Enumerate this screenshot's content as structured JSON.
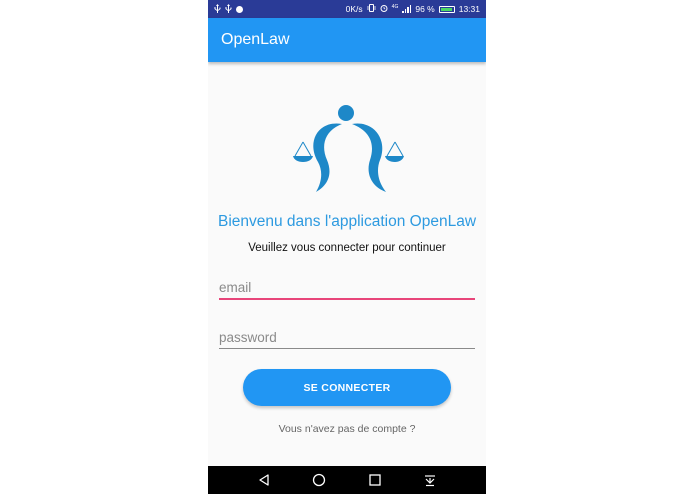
{
  "status_bar": {
    "speed": "0K/s",
    "network": "4G",
    "battery_percent": "96 %",
    "time": "13:31",
    "battery_color": "#4cd964",
    "icons": [
      "usb-icon",
      "usb-icon",
      "messenger-icon",
      "vibrate-icon",
      "alarm-icon",
      "signal-icon",
      "battery-icon"
    ]
  },
  "app_bar": {
    "title": "OpenLaw",
    "color": "#2196f3"
  },
  "logo": {
    "icon": "justice-scales-logo",
    "color": "#1e88c8"
  },
  "welcome": {
    "title": "Bienvenu dans l'application OpenLaw",
    "subtitle": "Veuillez vous connecter pour continuer"
  },
  "form": {
    "email_placeholder": "email",
    "password_placeholder": "password",
    "submit_label": "SE CONNECTER",
    "signup_label": "Vous n'avez pas de compte ?",
    "focus_color": "#e8457a"
  },
  "nav_bar": {
    "icons": [
      "back-icon",
      "home-icon",
      "recents-icon",
      "notification-pull-icon"
    ]
  }
}
